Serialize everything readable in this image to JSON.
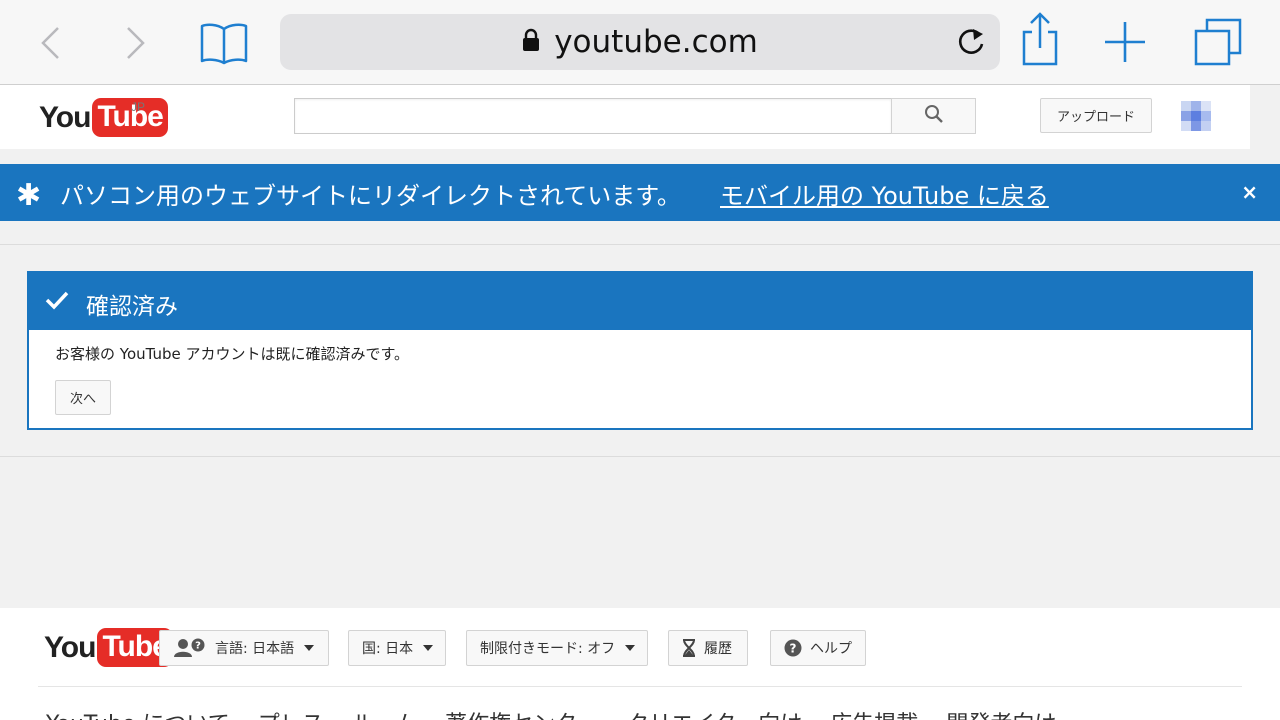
{
  "browser": {
    "url": "youtube.com",
    "icons": [
      "back-icon",
      "forward-icon",
      "bookmarks-icon",
      "lock-icon",
      "reload-icon",
      "share-icon",
      "new-tab-icon",
      "tabs-icon"
    ]
  },
  "header": {
    "logo_you": "You",
    "logo_tube": "Tube",
    "logo_region": "JP",
    "search_placeholder": "",
    "upload_label": "アップロード"
  },
  "banner": {
    "text": "パソコン用のウェブサイトにリダイレクトされています。",
    "link": "モバイル用の YouTube に戻る",
    "close": "×"
  },
  "card": {
    "title": "確認済み",
    "message": "お客様の YouTube アカウントは既に確認済みです。",
    "next_label": "次へ"
  },
  "footer": {
    "logo_you": "You",
    "logo_tube": "Tube",
    "language_label": "言語: 日本語",
    "country_label": "国: 日本",
    "restricted_label": "制限付きモード: オフ",
    "history_label": "履歴",
    "help_label": "ヘルプ",
    "links": [
      "YouTube について",
      "プレス",
      "ルーム",
      "著作権センター",
      "クリエイター向け",
      "広告掲載",
      "開発者向け"
    ]
  },
  "colors": {
    "accent_blue": "#1a75bf",
    "youtube_red": "#e52d27",
    "ios_blue": "#1f7fd0"
  }
}
